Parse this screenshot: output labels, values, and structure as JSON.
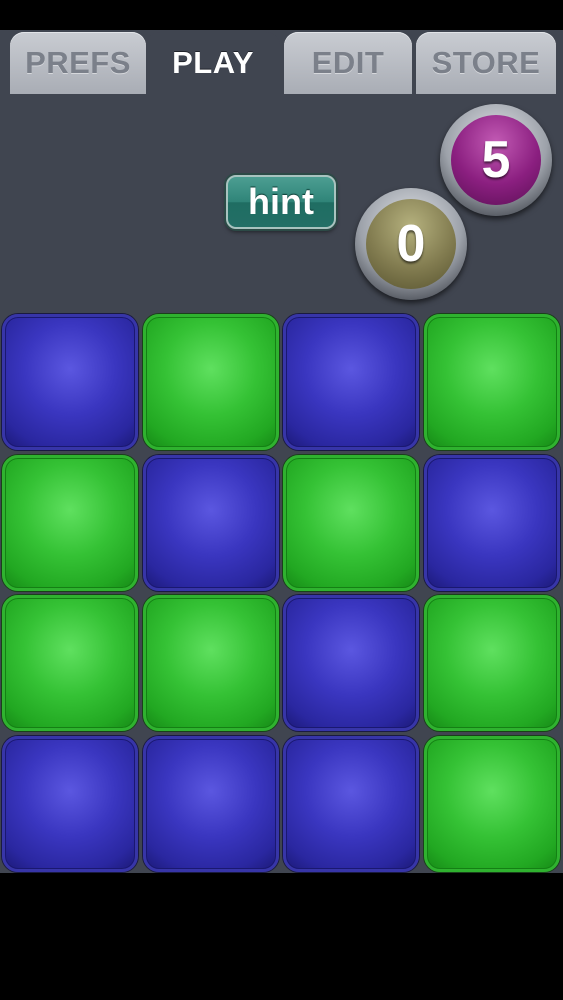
{
  "tabs": [
    {
      "id": "prefs",
      "label": "PREFS",
      "active": false
    },
    {
      "id": "play",
      "label": "PLAY",
      "active": true
    },
    {
      "id": "edit",
      "label": "EDIT",
      "active": false
    },
    {
      "id": "store",
      "label": "STORE",
      "active": false
    }
  ],
  "hint": {
    "label": "hint"
  },
  "counters": {
    "target": {
      "value": "5",
      "color": "#8b1f80"
    },
    "moves": {
      "value": "0",
      "color": "#827c50"
    }
  },
  "board": {
    "colors": {
      "blue": "#3a36c0",
      "green": "#35c235"
    },
    "rows": [
      [
        "blue",
        "green",
        "blue",
        "green"
      ],
      [
        "green",
        "blue",
        "green",
        "blue"
      ],
      [
        "green",
        "green",
        "blue",
        "green"
      ],
      [
        "blue",
        "blue",
        "blue",
        "green"
      ]
    ]
  }
}
